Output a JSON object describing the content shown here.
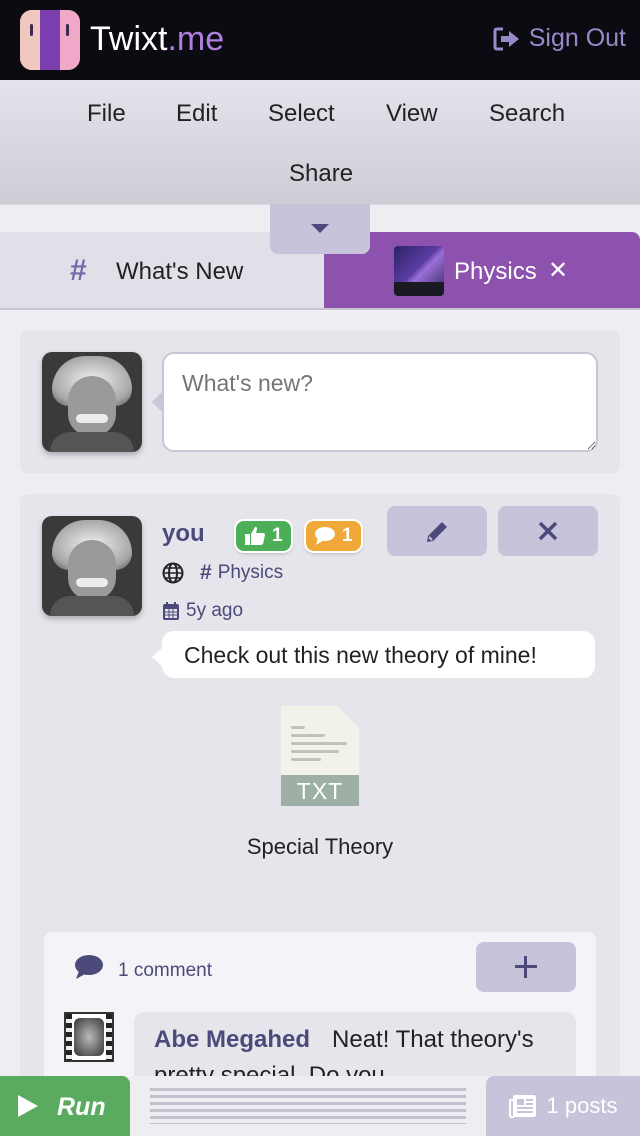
{
  "app": {
    "brand_name": "Twixt",
    "brand_tld": ".me",
    "sign_out_label": "Sign Out"
  },
  "menu": {
    "items": [
      "File",
      "Edit",
      "Select",
      "View",
      "Search",
      "Share"
    ]
  },
  "tabs": [
    {
      "label": "What's New",
      "icon": "hash-icon",
      "active": false
    },
    {
      "label": "Physics",
      "icon": "galaxy-thumbnail",
      "active": true,
      "close_label": "✕"
    }
  ],
  "compose": {
    "placeholder": "What's new?"
  },
  "post": {
    "author": "you",
    "likes": "1",
    "comments_badge": "1",
    "visibility_icon": "globe-icon",
    "channel": "Physics",
    "time_ago": "5y ago",
    "text": "Check out this new theory of mine!",
    "attachment": {
      "type": "TXT",
      "name": "Special Theory"
    },
    "comment_count_label": "1 comment",
    "comment": {
      "author": "Abe Megahed",
      "text": "Neat! That theory's pretty special. Do you"
    }
  },
  "footer": {
    "run_label": "Run",
    "posts_label": "1 posts"
  },
  "colors": {
    "accent_purple": "#8d52ad",
    "button_lavender": "#c6c3da",
    "text_indigo": "#4b4a7a",
    "like_green": "#4caf58",
    "comment_orange": "#f0a838",
    "run_green": "#5aaa60"
  }
}
